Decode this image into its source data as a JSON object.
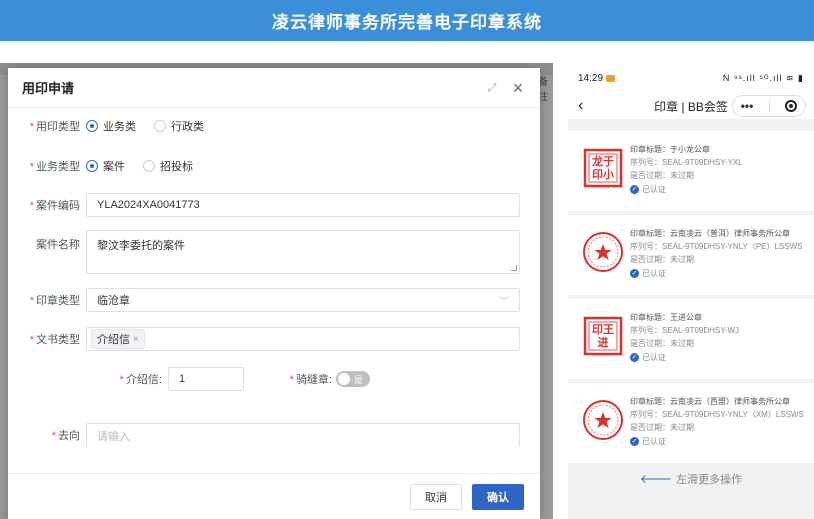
{
  "banner": {
    "title": "凌云律师事务所完善电子印章系统"
  },
  "backdrop": {
    "peek_right": "备注"
  },
  "dialog": {
    "title": "用印申请",
    "fields": {
      "seal_use_type": {
        "label": "用印类型",
        "options": [
          "业务类",
          "行政类"
        ],
        "selected": "业务类"
      },
      "business_type": {
        "label": "业务类型",
        "options": [
          "案件",
          "招投标"
        ],
        "selected": "案件"
      },
      "case_code": {
        "label": "案件编码",
        "value": "YLA2024XA0041773"
      },
      "case_name": {
        "label": "案件名称",
        "value": "黎汶李委托的案件"
      },
      "seal_type": {
        "label": "印章类型",
        "value": "临沧章"
      },
      "doc_type": {
        "label": "文书类型",
        "tag": "介绍信"
      },
      "intro_letter": {
        "label": "介绍信:",
        "value": "1"
      },
      "riding_seal": {
        "label": "骑缝章:",
        "toggle_text": "是"
      },
      "destination": {
        "label": "去向",
        "placeholder": "请输入"
      }
    },
    "buttons": {
      "cancel": "取消",
      "ok": "确认"
    }
  },
  "phone": {
    "time": "14:29",
    "status_icons": "N ⁹ˢ.ıll ⁵ᴳ.ıll ≋ ▮",
    "title": "印章 | BB会签",
    "capsule_more": "•••",
    "cards": [
      {
        "title": "印章标题：于小龙公章",
        "serial": "序列号：SEAL-9T09DHSY-YXL",
        "expired": "是否过期：未过期",
        "verified": "已认证",
        "seal_kind": "square",
        "seal_text": "龙于\n印小"
      },
      {
        "title": "印章标题：云南凌云（普洱）律师事务所公章",
        "serial": "序列号：SEAL-9T09DHSY-YNLY（PE）LSSWS",
        "expired": "是否过期：未过期",
        "verified": "已认证",
        "seal_kind": "round"
      },
      {
        "title": "印章标题：王进公章",
        "serial": "序列号：SEAL-9T09DHSY-WJ",
        "expired": "是否过期：未过期",
        "verified": "已认证",
        "seal_kind": "square",
        "seal_text": "印王\n进"
      },
      {
        "title": "印章标题：云南凌云（西盟）律师事务所公章",
        "serial": "序列号：SEAL-9T09DHSY-YNLY（XM）LSSWS",
        "expired": "是否过期：未过期",
        "verified": "已认证",
        "seal_kind": "round"
      }
    ],
    "swipe_hint": "左滑更多操作"
  },
  "colors": {
    "banner": "#3a8fd8",
    "primary": "#2f66c6",
    "seal_red": "#d6332f",
    "required": "#e84d4d"
  }
}
